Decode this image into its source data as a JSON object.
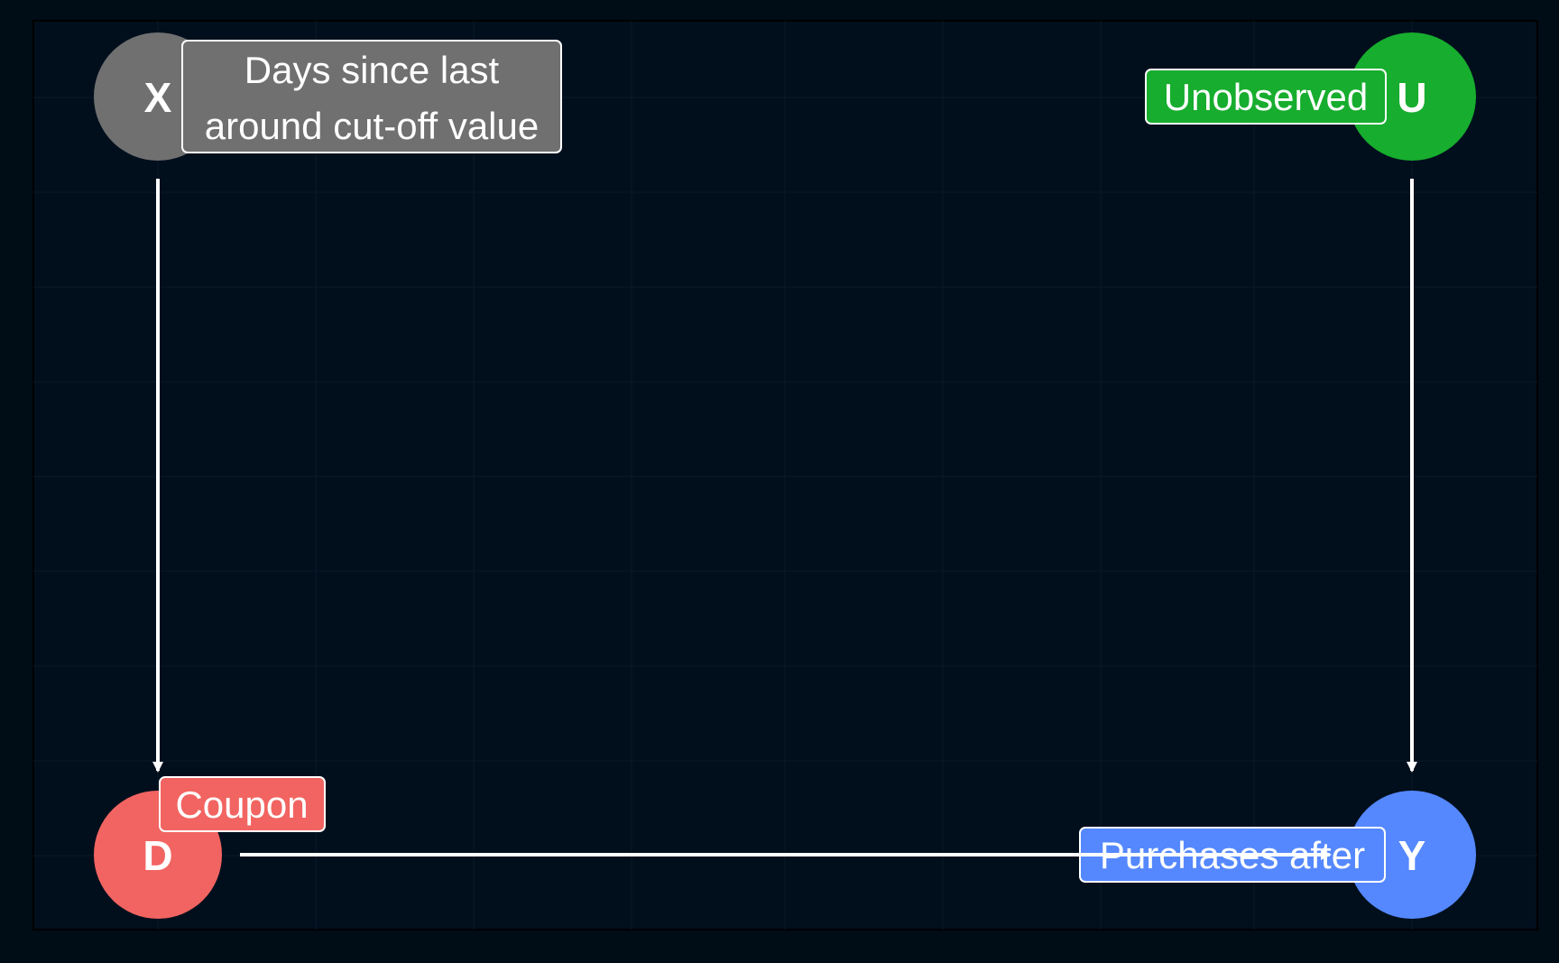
{
  "colors": {
    "background": "#02101c",
    "panel": "#010f1d",
    "edge": "#ffffff",
    "node_x": "#707070",
    "node_u": "#17ad2e",
    "node_d": "#f26461",
    "node_y": "#5588fe"
  },
  "nodes": {
    "x": {
      "letter": "X",
      "label_line1": "Days since last",
      "label_line2": "around cut-off value"
    },
    "u": {
      "letter": "U",
      "label": "Unobserved"
    },
    "d": {
      "letter": "D",
      "label": "Coupon"
    },
    "y": {
      "letter": "Y",
      "label": "Purchases after"
    }
  },
  "edges": [
    {
      "from": "X",
      "to": "D"
    },
    {
      "from": "U",
      "to": "Y"
    },
    {
      "from": "D",
      "to": "Y"
    }
  ]
}
